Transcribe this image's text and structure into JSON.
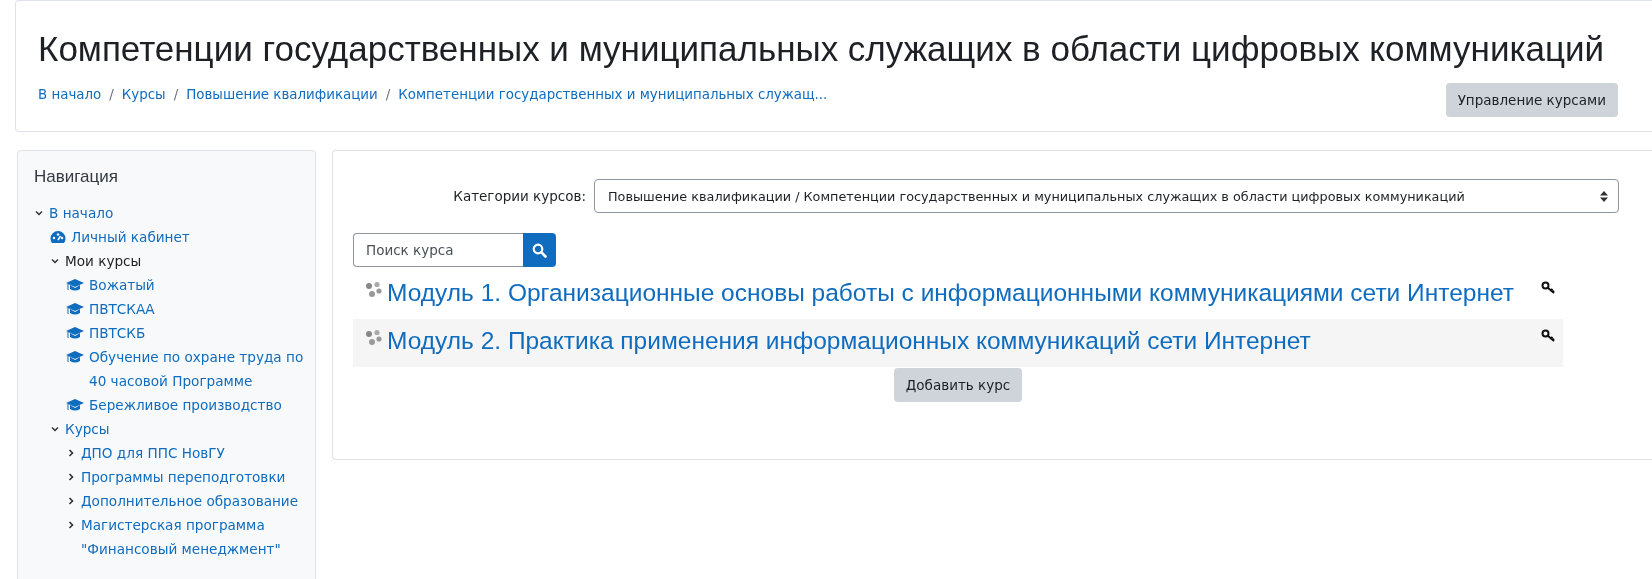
{
  "header": {
    "title": "Компетенции государственных и муниципальных служащих в области цифровых коммуникаций",
    "breadcrumbs": [
      {
        "kind": "link",
        "text": "В начало"
      },
      {
        "kind": "separator",
        "text": "/"
      },
      {
        "kind": "link",
        "text": "Курсы"
      },
      {
        "kind": "separator",
        "text": "/"
      },
      {
        "kind": "link",
        "text": "Повышение квалификации"
      },
      {
        "kind": "separator",
        "text": "/"
      },
      {
        "kind": "link",
        "text": "Компетенции государственных и муниципальных служащ..."
      }
    ],
    "manage_button": "Управление курсами"
  },
  "navigation": {
    "title": "Навигация",
    "items": [
      {
        "label": "В начало",
        "kind": "branch",
        "expanded": true,
        "link": true,
        "children": [
          {
            "label": "Личный кабинет",
            "kind": "dashboard",
            "link": true
          },
          {
            "label": "Мои курсы",
            "kind": "branch",
            "expanded": true,
            "link": false,
            "children": [
              {
                "label": "Вожатый",
                "kind": "course",
                "link": true
              },
              {
                "label": "ПВТСКАА",
                "kind": "course",
                "link": true
              },
              {
                "label": "ПВТСКБ",
                "kind": "course",
                "link": true
              },
              {
                "label": "Обучение по охране труда по 40 часовой Программе",
                "kind": "course",
                "link": true
              },
              {
                "label": "Бережливое производство",
                "kind": "course",
                "link": true
              }
            ]
          },
          {
            "label": "Курсы",
            "kind": "branch",
            "expanded": true,
            "link": true,
            "children": [
              {
                "label": "ДПО для ППС НовГУ",
                "kind": "branch",
                "expanded": false,
                "link": true
              },
              {
                "label": "Программы переподготовки",
                "kind": "branch",
                "expanded": false,
                "link": true
              },
              {
                "label": "Дополнительное образование",
                "kind": "branch",
                "expanded": false,
                "link": true
              },
              {
                "label": "Магистерская программа \"Финансовый менеджмент\"",
                "kind": "branch",
                "expanded": false,
                "link": true
              }
            ]
          }
        ]
      }
    ]
  },
  "main": {
    "category_label": "Категории курсов:",
    "category_value": "Повышение квалификации / Компетенции государственных и муниципальных служащих в области цифровых коммуникаций",
    "search": {
      "placeholder": "Поиск курса"
    },
    "courses": [
      {
        "name": "Модуль 1. Организационные основы работы с информационными коммуникациями сети Интернет"
      },
      {
        "name": "Модуль 2. Практика применения информационных коммуникаций сети Интернет"
      }
    ],
    "add_button": "Добавить курс"
  }
}
